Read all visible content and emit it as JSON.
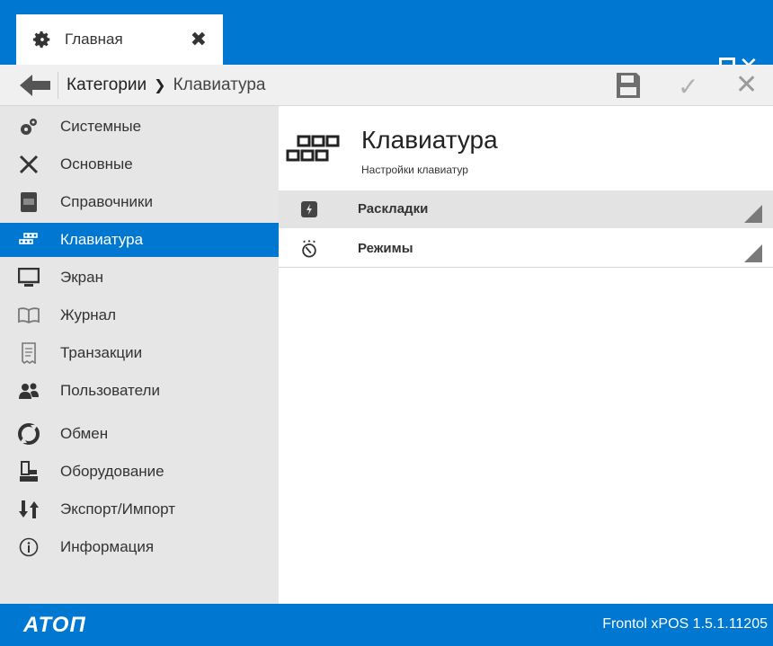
{
  "titlebar": {
    "tab_label": "Главная",
    "accent": "#0078d2"
  },
  "toolbar": {
    "crumb_root": "Категории",
    "crumb_current": "Клавиатура"
  },
  "sidebar": {
    "items": [
      {
        "label": "Системные",
        "icon": "gears-icon"
      },
      {
        "label": "Основные",
        "icon": "tools-icon"
      },
      {
        "label": "Справочники",
        "icon": "book-icon"
      },
      {
        "label": "Клавиатура",
        "icon": "keyboard-icon",
        "active": true
      },
      {
        "label": "Экран",
        "icon": "monitor-icon"
      },
      {
        "label": "Журнал",
        "icon": "journal-icon"
      },
      {
        "label": "Транзакции",
        "icon": "receipt-icon"
      },
      {
        "label": "Пользователи",
        "icon": "users-icon"
      },
      {
        "label": "Обмен",
        "icon": "sync-icon"
      },
      {
        "label": "Оборудование",
        "icon": "cash-register-icon"
      },
      {
        "label": "Экспорт/Импорт",
        "icon": "export-import-icon"
      },
      {
        "label": "Информация",
        "icon": "info-icon"
      }
    ]
  },
  "content": {
    "title": "Клавиатура",
    "subtitle": "Настройки клавиатур",
    "rows": [
      {
        "label": "Раскладки",
        "icon": "layout-icon"
      },
      {
        "label": "Режимы",
        "icon": "timer-icon"
      }
    ]
  },
  "statusbar": {
    "logo": "ATOΠ",
    "version": "Frontol xPOS 1.5.1.11205"
  }
}
